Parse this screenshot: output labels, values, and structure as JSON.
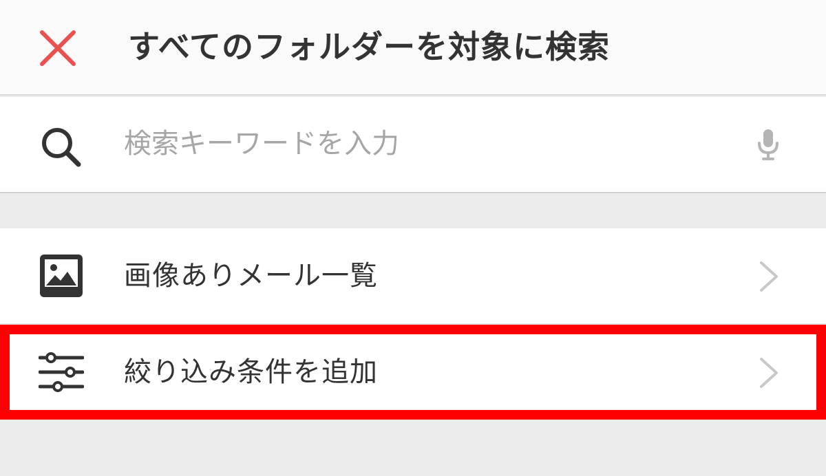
{
  "header": {
    "title": "すべてのフォルダーを対象に検索",
    "close_icon": "close-icon",
    "close_color": "#e95151"
  },
  "search": {
    "value": "",
    "placeholder": "検索キーワードを入力",
    "search_icon": "search-icon",
    "mic_icon": "microphone-icon"
  },
  "list": {
    "items": [
      {
        "label": "画像ありメール一覧",
        "icon": "image-icon",
        "trailing": "chevron-right-icon"
      },
      {
        "label": "絞り込み条件を追加",
        "icon": "filter-sliders-icon",
        "trailing": "chevron-right-icon",
        "highlighted": true
      }
    ]
  },
  "colors": {
    "highlight": "#ff0000",
    "text": "#333333",
    "placeholder": "#a6a6a6",
    "background": "#ececec"
  }
}
